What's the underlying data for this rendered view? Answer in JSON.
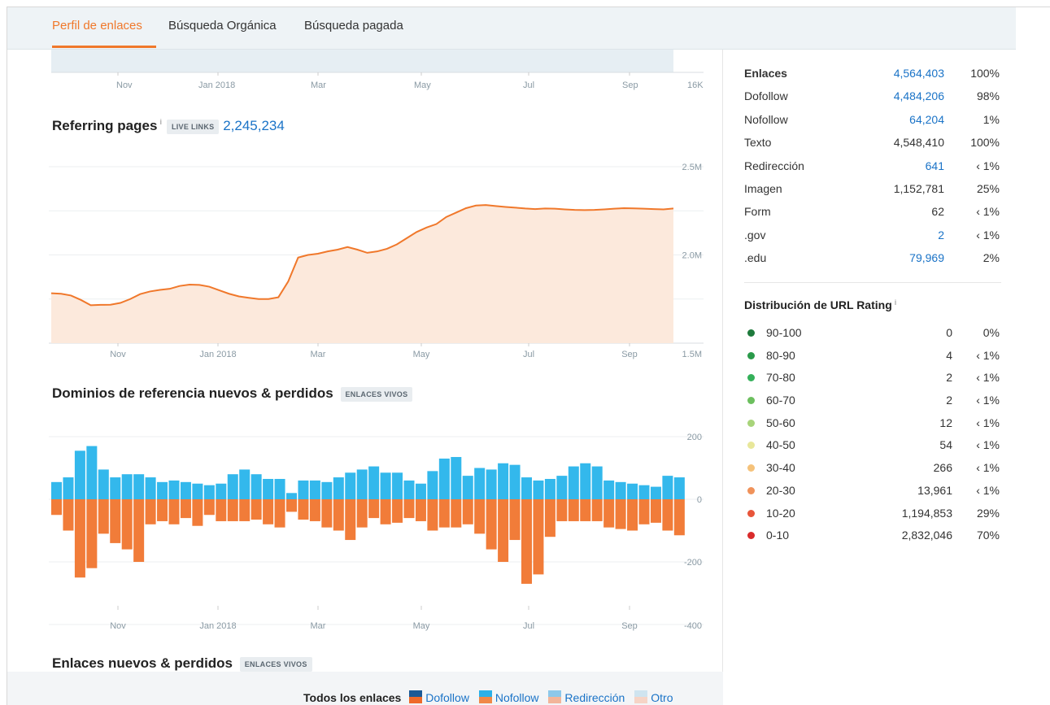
{
  "tabs": [
    {
      "label": "Perfil de enlaces",
      "active": true
    },
    {
      "label": "Búsqueda Orgánica",
      "active": false
    },
    {
      "label": "Búsqueda pagada",
      "active": false
    }
  ],
  "top_chart": {
    "x_ticks": [
      "Nov",
      "Jan 2018",
      "Mar",
      "May",
      "Jul",
      "Sep"
    ],
    "y_label": "16K"
  },
  "referring_pages": {
    "title": "Referring pages",
    "info": "i",
    "tag": "LIVE LINKS",
    "count": "2,245,234"
  },
  "domains_section": {
    "title": "Dominios de referencia nuevos & perdidos",
    "tag": "ENLACES VIVOS"
  },
  "links_section": {
    "title": "Enlaces nuevos & perdidos",
    "tag": "ENLACES VIVOS"
  },
  "legend": {
    "lead": "Todos los enlaces",
    "items": [
      {
        "label": "Dofollow",
        "top": "#1b5a96",
        "bottom": "#ee6a2a"
      },
      {
        "label": "Nofollow",
        "top": "#2bb0e8",
        "bottom": "#f08848"
      },
      {
        "label": "Redirección",
        "top": "#8cc8ea",
        "bottom": "#f2b59a"
      },
      {
        "label": "Otro",
        "top": "#cfe4ef",
        "bottom": "#f6d4c6"
      }
    ]
  },
  "stats": [
    {
      "label": "Enlaces",
      "value": "4,564,403",
      "pct": "100%",
      "link": true,
      "bold": true
    },
    {
      "label": "Dofollow",
      "value": "4,484,206",
      "pct": "98%",
      "link": true
    },
    {
      "label": "Nofollow",
      "value": "64,204",
      "pct": "1%",
      "link": true
    },
    {
      "label": "Texto",
      "value": "4,548,410",
      "pct": "100%",
      "link": false
    },
    {
      "label": "Redirección",
      "value": "641",
      "pct": "‹ 1%",
      "link": true
    },
    {
      "label": "Imagen",
      "value": "1,152,781",
      "pct": "25%",
      "link": false
    },
    {
      "label": "Form",
      "value": "62",
      "pct": "‹ 1%",
      "link": false
    },
    {
      "label": ".gov",
      "value": "2",
      "pct": "‹ 1%",
      "link": true
    },
    {
      "label": ".edu",
      "value": "79,969",
      "pct": "2%",
      "link": true
    }
  ],
  "url_rating": {
    "title": "Distribución de URL Rating",
    "info": "i",
    "rows": [
      {
        "range": "90-100",
        "count": "0",
        "pct": "0%",
        "color": "#1e7a3c"
      },
      {
        "range": "80-90",
        "count": "4",
        "pct": "‹ 1%",
        "color": "#2a9a4a"
      },
      {
        "range": "70-80",
        "count": "2",
        "pct": "‹ 1%",
        "color": "#34b05a"
      },
      {
        "range": "60-70",
        "count": "2",
        "pct": "‹ 1%",
        "color": "#6cbf5e"
      },
      {
        "range": "50-60",
        "count": "12",
        "pct": "‹ 1%",
        "color": "#a8d47a"
      },
      {
        "range": "40-50",
        "count": "54",
        "pct": "‹ 1%",
        "color": "#e8e79a"
      },
      {
        "range": "30-40",
        "count": "266",
        "pct": "‹ 1%",
        "color": "#f5c27a"
      },
      {
        "range": "20-30",
        "count": "13,961",
        "pct": "‹ 1%",
        "color": "#f0925a"
      },
      {
        "range": "10-20",
        "count": "1,194,853",
        "pct": "29%",
        "color": "#e8553a"
      },
      {
        "range": "0-10",
        "count": "2,832,046",
        "pct": "70%",
        "color": "#d92b2b"
      }
    ]
  },
  "chart_data": [
    {
      "type": "area",
      "title": "Referring pages",
      "x_ticks": [
        "Nov",
        "Jan 2018",
        "Mar",
        "May",
        "Jul",
        "Sep"
      ],
      "y_ticks": [
        "2.5M",
        "2.0M",
        "1.5M"
      ],
      "ylim": [
        1500000,
        2500000
      ],
      "x": [
        0,
        5,
        10,
        15,
        20,
        25,
        30,
        35,
        40,
        45,
        50,
        55,
        60,
        65,
        70,
        75,
        80,
        85,
        90,
        95,
        100,
        105,
        110,
        115,
        120,
        125,
        130,
        135,
        140,
        145,
        150,
        155,
        160,
        165,
        170,
        175,
        180,
        185,
        190,
        195,
        200,
        205,
        210,
        215,
        220,
        225,
        230,
        235,
        240,
        245,
        250,
        255,
        260,
        265,
        270,
        275,
        280,
        285,
        290,
        295,
        300,
        305,
        310,
        315
      ],
      "values": [
        1783000,
        1780000,
        1770000,
        1745000,
        1715000,
        1717000,
        1718000,
        1728000,
        1750000,
        1778000,
        1793000,
        1802000,
        1808000,
        1824000,
        1832000,
        1830000,
        1820000,
        1800000,
        1780000,
        1765000,
        1757000,
        1750000,
        1750000,
        1760000,
        1850000,
        1985000,
        2000000,
        2007000,
        2020000,
        2030000,
        2045000,
        2030000,
        2012000,
        2020000,
        2035000,
        2060000,
        2095000,
        2130000,
        2155000,
        2175000,
        2215000,
        2240000,
        2265000,
        2280000,
        2283000,
        2277000,
        2272000,
        2268000,
        2263000,
        2260000,
        2263000,
        2262000,
        2258000,
        2255000,
        2254000,
        2255000,
        2258000,
        2262000,
        2265000,
        2264000,
        2262000,
        2260000,
        2258000,
        2263000
      ],
      "color": "#f0782b"
    },
    {
      "type": "bar",
      "title": "Dominios de referencia nuevos & perdidos",
      "x_ticks": [
        "Nov",
        "Jan 2018",
        "Mar",
        "May",
        "Jul",
        "Sep"
      ],
      "y_ticks": [
        "200",
        "0",
        "-200",
        "-400"
      ],
      "ylim": [
        -400,
        200
      ],
      "series": [
        {
          "name": "new",
          "values": [
            55,
            70,
            155,
            170,
            95,
            70,
            80,
            80,
            70,
            55,
            60,
            55,
            50,
            45,
            50,
            80,
            95,
            80,
            65,
            65,
            20,
            60,
            60,
            55,
            70,
            85,
            95,
            105,
            85,
            85,
            60,
            50,
            90,
            130,
            135,
            75,
            100,
            95,
            115,
            110,
            70,
            60,
            65,
            75,
            105,
            115,
            105,
            60,
            55,
            50,
            45,
            40,
            75,
            70
          ]
        },
        {
          "name": "lost",
          "values": [
            -50,
            -100,
            -250,
            -220,
            -110,
            -140,
            -160,
            -200,
            -80,
            -70,
            -80,
            -60,
            -85,
            -50,
            -70,
            -70,
            -70,
            -65,
            -80,
            -90,
            -40,
            -65,
            -70,
            -90,
            -100,
            -130,
            -90,
            -60,
            -80,
            -75,
            -60,
            -70,
            -100,
            -90,
            -90,
            -80,
            -110,
            -160,
            -200,
            -130,
            -270,
            -240,
            -120,
            -70,
            -70,
            -70,
            -70,
            -90,
            -95,
            -100,
            -80,
            -75,
            -100,
            -115
          ]
        }
      ],
      "colors": {
        "new": "#33b8ec",
        "lost": "#f17c39"
      }
    }
  ]
}
